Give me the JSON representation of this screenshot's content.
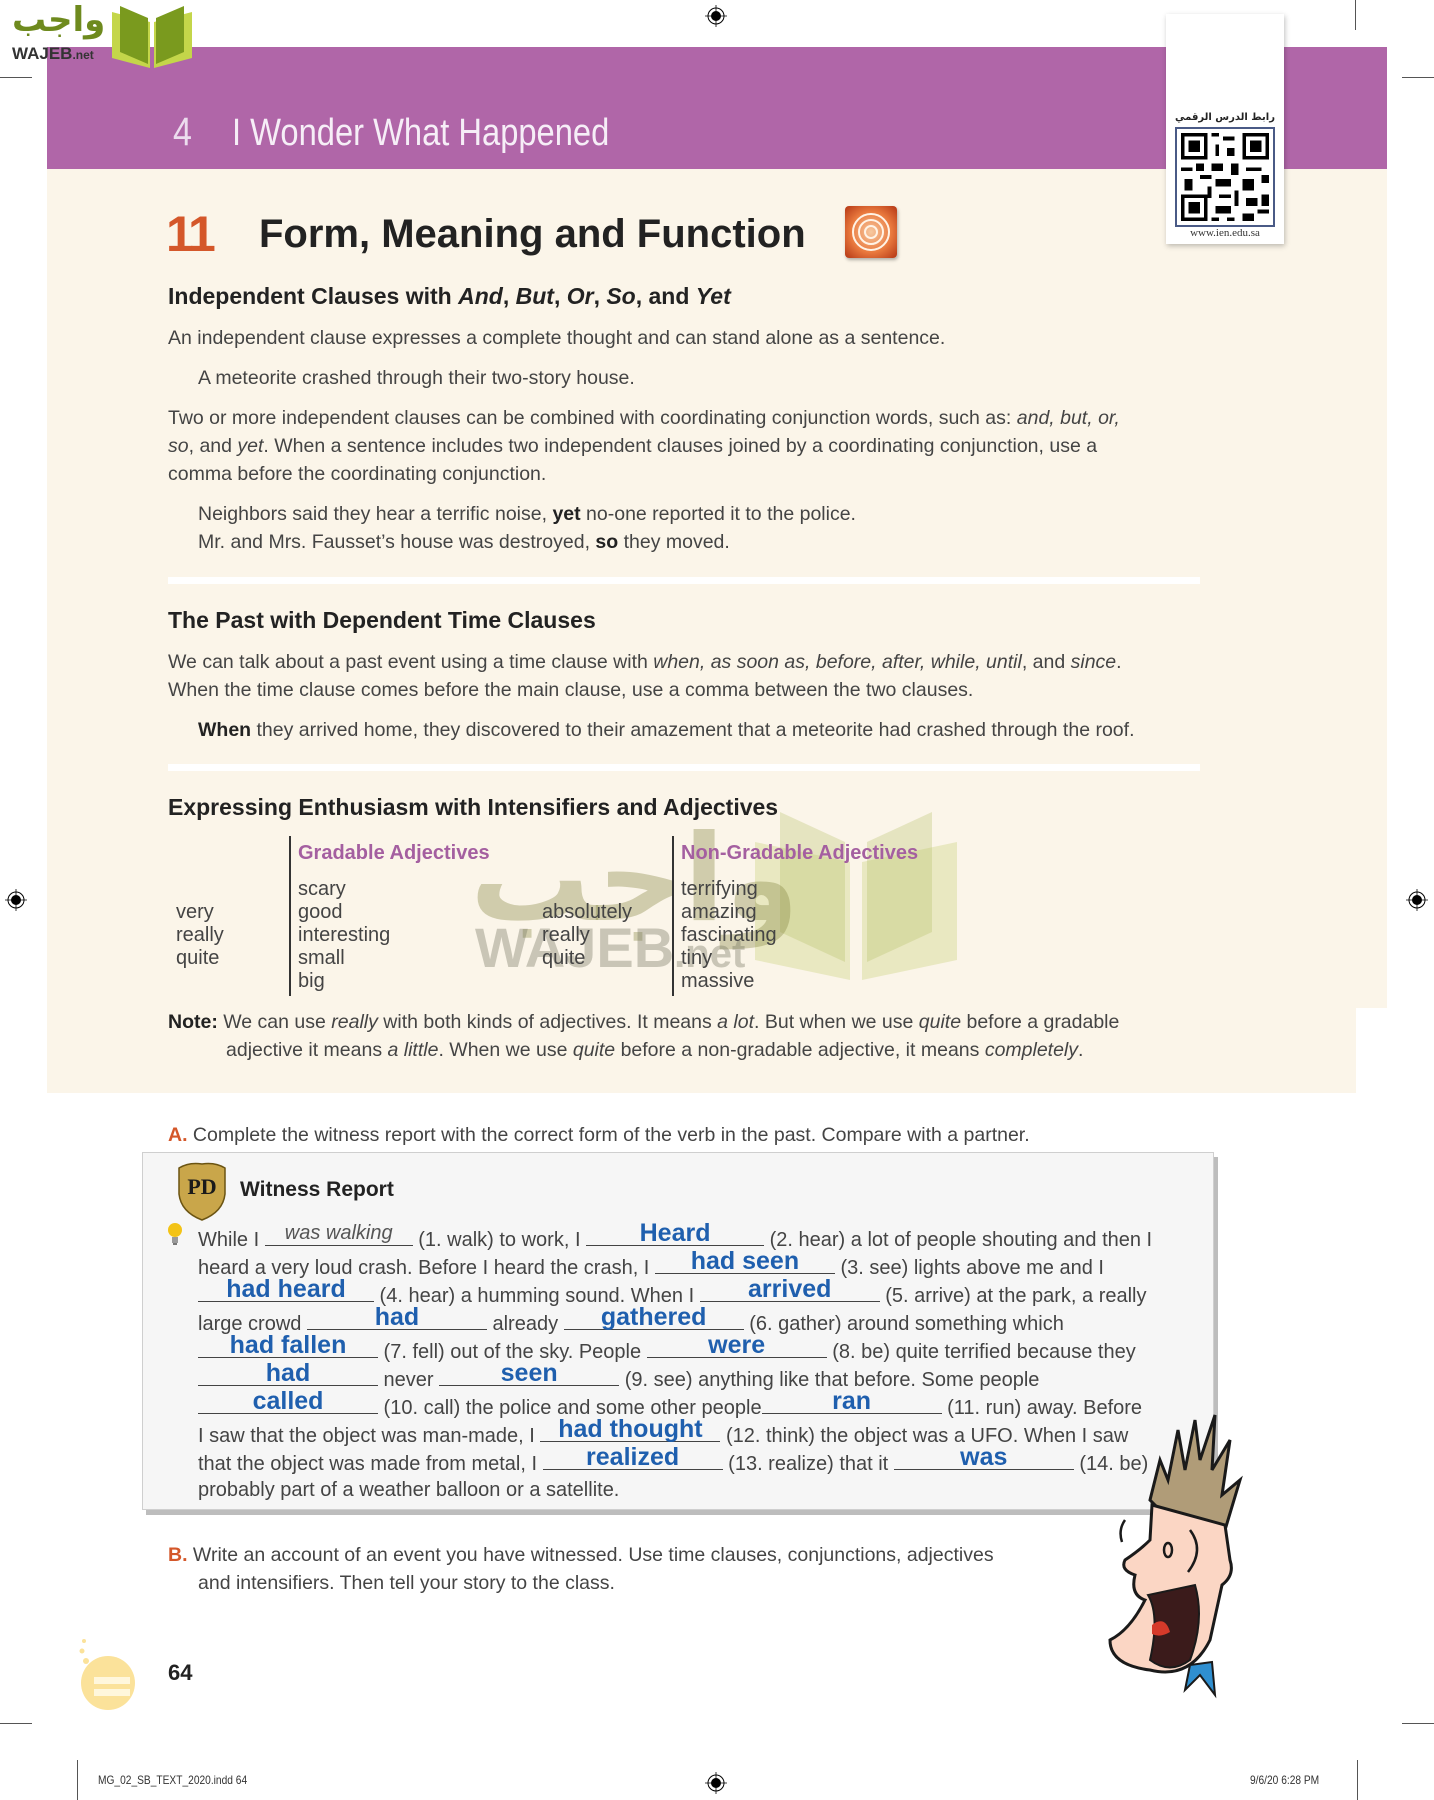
{
  "logo": {
    "arabic": "واجب",
    "latin": "WAJEB",
    "latin_suffix": ".net"
  },
  "header": {
    "unit_number": "4",
    "unit_title": "I Wonder What Happened"
  },
  "qr": {
    "label": "رابط الدرس الرقمي",
    "url": "www.ien.edu.sa"
  },
  "lesson": {
    "number": "11",
    "title": "Form, Meaning and Function",
    "icon": "spiral-icon"
  },
  "section1": {
    "heading_parts": [
      "Independent Clauses with ",
      "And",
      ", ",
      "But",
      ", ",
      "Or",
      ", ",
      "So",
      ", and ",
      "Yet"
    ],
    "p1": "An independent clause expresses a complete thought and can stand alone as a sentence.",
    "example1": "A meteorite crashed through their two-story house.",
    "p2_line1_a": "Two or more independent clauses can be combined with coordinating conjunction words, such as: ",
    "p2_line1_b": "and, but, or,",
    "p2_line2_a": "so",
    "p2_line2_b": ", and ",
    "p2_line2_c": "yet",
    "p2_line2_d": ". When a sentence includes two independent clauses joined by a coordinating conjunction, use a",
    "p2_line3": "comma before the coordinating conjunction.",
    "example2_a": "Neighbors said they hear a terrific noise, ",
    "example2_b": "yet",
    "example2_c": " no-one reported it to the police.",
    "example3_a": "Mr. and Mrs. Fausset’s house was destroyed, ",
    "example3_b": "so",
    "example3_c": " they moved."
  },
  "section2": {
    "heading": "The Past with Dependent Time Clauses",
    "line1_a": "We can talk about a past event using a time clause with ",
    "line1_b": "when, as soon as, before, after, while, until",
    "line1_c": ", and ",
    "line1_d": "since",
    "line1_e": ".",
    "line2": "When the time clause comes before the main clause, use a comma between the two clauses.",
    "example_a": "When",
    "example_b": " they arrived home, they discovered to their amazement that a meteorite had crashed through the roof."
  },
  "section3": {
    "heading": "Expressing Enthusiasm with Intensifiers and Adjectives",
    "gradable_intensifiers": [
      "very",
      "really",
      "quite"
    ],
    "gradable_header": "Gradable Adjectives",
    "gradable_adjectives": [
      "scary",
      "good",
      "interesting",
      "small",
      "big"
    ],
    "nongradable_intensifiers": [
      "absolutely",
      "really",
      "quite"
    ],
    "nongradable_header": "Non-Gradable Adjectives",
    "nongradable_adjectives": [
      "terrifying",
      "amazing",
      "fascinating",
      "tiny",
      "massive"
    ],
    "note_label": "Note:",
    "note_1a": " We can use ",
    "note_1b": "really",
    "note_1c": " with both kinds of adjectives. It means ",
    "note_1d": "a lot",
    "note_1e": ". But when we use ",
    "note_1f": "quite",
    "note_1g": " before a gradable",
    "note_2a": "adjective it means ",
    "note_2b": "a little",
    "note_2c": ". When we use ",
    "note_2d": "quite",
    "note_2e": " before a non-gradable adjective, it means ",
    "note_2f": "completely",
    "note_2g": "."
  },
  "exercise_a": {
    "letter": "A.",
    "instruction": "Complete the witness report with the correct form of the verb in the past. Compare with a partner.",
    "box_title": "Witness Report",
    "badge": "PD",
    "text": {
      "l1a": "While I ",
      "l1b": " (1. walk) to work, I ",
      "l1c": " (2. hear) a lot of people shouting and then I",
      "l2a": "heard a very  loud crash. Before I heard the crash, I ",
      "l2b": " (3. see) lights above me and I",
      "l3a": " (4. hear) a humming sound. When I ",
      "l3b": " (5. arrive) at the park, a really",
      "l4a": "large crowd ",
      "l4b": " already ",
      "l4c": " (6. gather) around something which",
      "l5a": " (7. fell) out of the sky. People ",
      "l5b": " (8. be) quite terrified because they",
      "l6a": " never ",
      "l6b": " (9. see) anything like that before. Some people",
      "l7a": " (10. call) the police and some other people",
      "l7b": " (11. run) away. Before",
      "l8a": "I saw that the object was man-made, I ",
      "l8b": " (12. think) the object was a UFO. When I saw",
      "l9a": "that the object was made from metal, I ",
      "l9b": " (13. realize) that it ",
      "l9c": " (14. be)",
      "l10": "probably part of a weather balloon or a satellite."
    },
    "answers": [
      "was walking",
      "Heard",
      "had seen",
      "had heard",
      "arrived",
      "had",
      "gathered",
      "had fallen",
      "were",
      "had",
      "seen",
      "called",
      "ran",
      "had thought",
      "realized",
      "was"
    ]
  },
  "exercise_b": {
    "letter": "B.",
    "line1": "Write an account of an event you have witnessed. Use time clauses, conjunctions, adjectives",
    "line2": "and intensifiers. Then tell your story to the class."
  },
  "page_number": "64",
  "slug": {
    "file": "MG_02_SB_TEXT_2020.indd   64",
    "date": "9/6/20   6:28 PM"
  },
  "colors": {
    "header_purple": "#b066a8",
    "panel_beige": "#fbf5e9",
    "accent_orange": "#d4572a",
    "answer_blue": "#1f5fae",
    "subhead_purple": "#a45fa0"
  }
}
